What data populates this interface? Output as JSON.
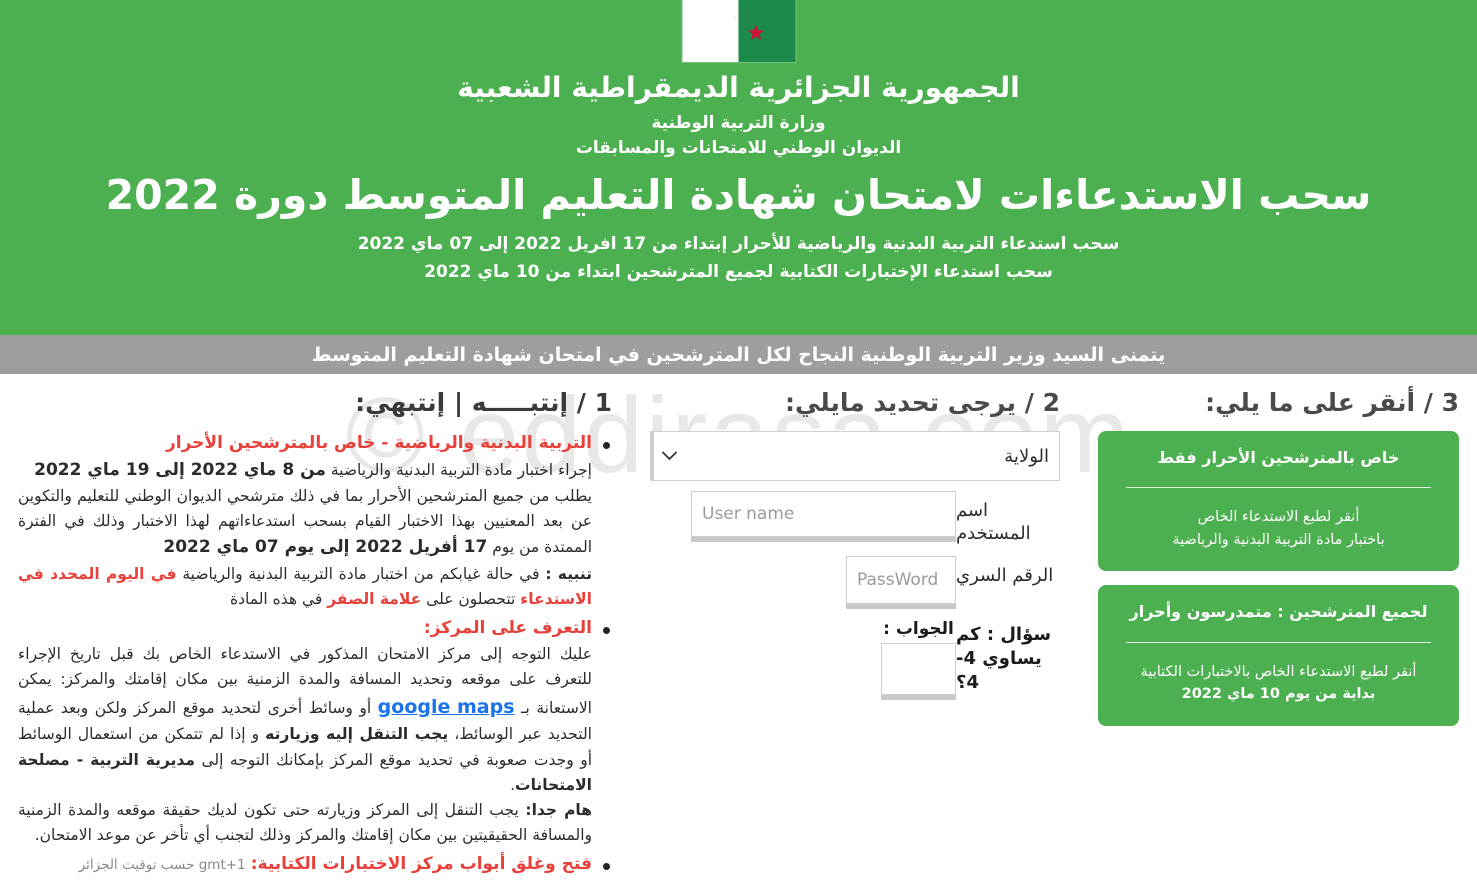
{
  "watermark": "© eddirasa.com",
  "header": {
    "flag_alt": "algeria-flag",
    "republic": "الجمهورية الجزائرية الديمقراطية الشعبية",
    "ministry": "وزارة التربية الوطنية",
    "office": "الديوان الوطني للامتحانات والمسابقات",
    "main_title": "سحب الاستدعاءات لامتحان شهادة التعليم المتوسط دورة 2022",
    "sub_line_1": "سحب استدعاء التربية البدنية والرياضية للأحرار إبتداء من 17 افريل 2022 إلى 07 ماي 2022",
    "sub_line_2": "سحب استدعاء الإختبارات الكتابية لجميع المترشحين ابتداء من 10 ماي 2022",
    "bg_color": "#4cb050"
  },
  "banner": {
    "text": "يتمنى السيد وزير التربية الوطنية النجاح لكل المترشحين في امتحان شهادة التعليم المتوسط",
    "bg_color": "#9e9e9e"
  },
  "column_right": {
    "heading": "1 / إنتبـــــه | إنتبهي:",
    "bullet_1": {
      "title": "التربية البدنية والرياضية - خاص بالمترشحين الأحرار",
      "p1_pre": "إجراء اختبار مادة التربية البدنية والرياضية ",
      "p1_bold": "من 8 ماي 2022 إلى 19 ماي 2022",
      "p2": "يطلب من جميع المترشحين الأحرار بما في ذلك مترشحي الديوان الوطني للتعليم والتكوين عن بعد المعنيين بهذا الاختبار القيام بسحب استدعاءاتهم لهذا الاختبار وذلك في الفترة الممتدة من يوم ",
      "p2_bold": "17 أفريل 2022 إلى يوم 07 ماي 2022",
      "note_label": "تنبيه :",
      "note_pre": " في حالة غيابكم من اختبار مادة التربية البدنية والرياضية ",
      "note_red_1": "في اليوم المحدد في الاستدعاء",
      "note_mid": " تتحصلون على ",
      "note_red_2": "علامة الصفر",
      "note_post": " في هذه المادة"
    },
    "bullet_2": {
      "title": "التعرف على المركز:",
      "p1": "عليك التوجه إلى مركز الامتحان المذكور في الاستدعاء الخاص بك قبل تاريخ الإجراء للتعرف على موقعه وتحديد المسافة والمدة الزمنية بين مكان إقامتك والمركز: يمكن الاستعانة بـ",
      "gmaps_link": "google maps",
      "p2_pre": " أو وسائط أخرى لتحديد موقع المركز ولكن وبعد عملية التحديد عبر الوسائط، ",
      "p2_bold_1": "يجب التنقل إليه وزيارته",
      "p2_mid": " و إذا لم تتمكن من استعمال الوسائط أو وجدت صعوبة في تحديد موقع المركز بإمكانك التوجه إلى ",
      "p2_bold_2": "مديرية التربية - مصلحة الامتحانات",
      "p2_end": ".",
      "important_label": "هام جدا:",
      "important_text": " يجب التنقل إلى المركز وزيارته حتى تكون لديك حقيقة موقعه والمدة الزمنية والمسافة الحقيقيتين بين مكان إقامتك والمركز وذلك لتجنب أي تأخر عن موعد الامتحان."
    },
    "bullet_3": {
      "title": "فتح وغلق أبواب مركز الاختبارات الكتابية:",
      "note": "حسب توقيت الجزائر gmt+1"
    }
  },
  "column_middle": {
    "heading": "2 / يرجى تحديد مايلي:",
    "wilaya_label": "الولاية",
    "wilaya_selected": "الولاية",
    "wilaya_options": [
      "الولاية"
    ],
    "username_label": "اسم المستخدم",
    "username_placeholder": "User name",
    "username_value": "",
    "password_label": "الرقم السري",
    "password_placeholder": "PassWord",
    "password_value": "",
    "question_label": "سؤال : كم يساوي 4-4؟",
    "answer_label": "الجواب :",
    "answer_value": ""
  },
  "column_left": {
    "heading": "3 / أنقر على ما يلي:",
    "button_1": {
      "top": "خاص بالمترشحين الأحرار فقط",
      "sub_line_1": "أنقر لطبع الاستدعاء الخاص",
      "sub_line_2": "باختبار مادة التربية البدنية والرياضية"
    },
    "button_2": {
      "top": "لجميع المترشحين : متمدرسون وأحرار",
      "sub_line_1": "أنقر لطبع الاستدعاء الخاص بالاختبارات الكتابية",
      "sub_line_2": "بداية من يوم 10 ماي 2022"
    },
    "button_color": "#4cb050"
  }
}
